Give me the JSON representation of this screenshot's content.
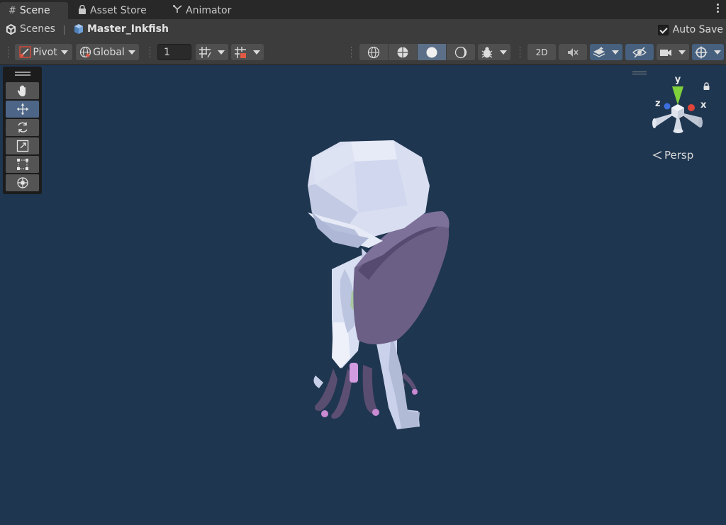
{
  "tabs": [
    {
      "label": "Scene",
      "icon": "scene-grid-icon",
      "active": true
    },
    {
      "label": "Asset Store",
      "icon": "shopping-bag-icon",
      "active": false
    },
    {
      "label": "Animator",
      "icon": "animator-icon",
      "active": false
    }
  ],
  "breadcrumb": {
    "root": "Scenes",
    "current": "Master_Inkfish"
  },
  "autosave": {
    "label": "Auto Save",
    "checked": true
  },
  "toolbar": {
    "pivot": "Pivot",
    "global": "Global",
    "grid_size": "1",
    "mode_2d": "2D"
  },
  "tools": [
    {
      "name": "hand-tool",
      "icon": "hand-icon"
    },
    {
      "name": "move-tool",
      "icon": "move-arrows-icon",
      "selected": true
    },
    {
      "name": "rotate-tool",
      "icon": "rotate-icon"
    },
    {
      "name": "scale-tool",
      "icon": "scale-icon"
    },
    {
      "name": "rect-tool",
      "icon": "rect-icon"
    },
    {
      "name": "transform-tool",
      "icon": "transform-icon"
    }
  ],
  "gizmo": {
    "x": "x",
    "y": "y",
    "z": "z",
    "projection": "Persp"
  },
  "colors": {
    "scene_bg": "#1f3650",
    "toolbar": "#3c3c3c",
    "tabbar": "#282828",
    "selected": "#4d6587",
    "x_axis": "#e0453a",
    "y_axis": "#7fd13b",
    "z_axis": "#3c6fe0"
  }
}
